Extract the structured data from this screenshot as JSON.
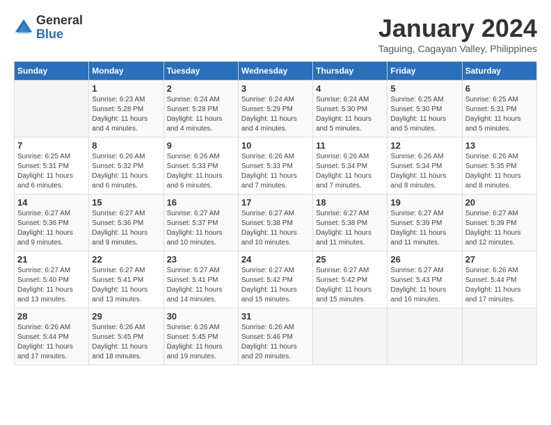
{
  "header": {
    "logo_general": "General",
    "logo_blue": "Blue",
    "month_title": "January 2024",
    "subtitle": "Taguing, Cagayan Valley, Philippines"
  },
  "weekdays": [
    "Sunday",
    "Monday",
    "Tuesday",
    "Wednesday",
    "Thursday",
    "Friday",
    "Saturday"
  ],
  "weeks": [
    [
      {
        "day": "",
        "info": ""
      },
      {
        "day": "1",
        "info": "Sunrise: 6:23 AM\nSunset: 5:28 PM\nDaylight: 11 hours\nand 4 minutes."
      },
      {
        "day": "2",
        "info": "Sunrise: 6:24 AM\nSunset: 5:28 PM\nDaylight: 11 hours\nand 4 minutes."
      },
      {
        "day": "3",
        "info": "Sunrise: 6:24 AM\nSunset: 5:29 PM\nDaylight: 11 hours\nand 4 minutes."
      },
      {
        "day": "4",
        "info": "Sunrise: 6:24 AM\nSunset: 5:30 PM\nDaylight: 11 hours\nand 5 minutes."
      },
      {
        "day": "5",
        "info": "Sunrise: 6:25 AM\nSunset: 5:30 PM\nDaylight: 11 hours\nand 5 minutes."
      },
      {
        "day": "6",
        "info": "Sunrise: 6:25 AM\nSunset: 5:31 PM\nDaylight: 11 hours\nand 5 minutes."
      }
    ],
    [
      {
        "day": "7",
        "info": "Sunrise: 6:25 AM\nSunset: 5:31 PM\nDaylight: 11 hours\nand 6 minutes."
      },
      {
        "day": "8",
        "info": "Sunrise: 6:26 AM\nSunset: 5:32 PM\nDaylight: 11 hours\nand 6 minutes."
      },
      {
        "day": "9",
        "info": "Sunrise: 6:26 AM\nSunset: 5:33 PM\nDaylight: 11 hours\nand 6 minutes."
      },
      {
        "day": "10",
        "info": "Sunrise: 6:26 AM\nSunset: 5:33 PM\nDaylight: 11 hours\nand 7 minutes."
      },
      {
        "day": "11",
        "info": "Sunrise: 6:26 AM\nSunset: 5:34 PM\nDaylight: 11 hours\nand 7 minutes."
      },
      {
        "day": "12",
        "info": "Sunrise: 6:26 AM\nSunset: 5:34 PM\nDaylight: 11 hours\nand 8 minutes."
      },
      {
        "day": "13",
        "info": "Sunrise: 6:26 AM\nSunset: 5:35 PM\nDaylight: 11 hours\nand 8 minutes."
      }
    ],
    [
      {
        "day": "14",
        "info": "Sunrise: 6:27 AM\nSunset: 5:36 PM\nDaylight: 11 hours\nand 9 minutes."
      },
      {
        "day": "15",
        "info": "Sunrise: 6:27 AM\nSunset: 5:36 PM\nDaylight: 11 hours\nand 9 minutes."
      },
      {
        "day": "16",
        "info": "Sunrise: 6:27 AM\nSunset: 5:37 PM\nDaylight: 11 hours\nand 10 minutes."
      },
      {
        "day": "17",
        "info": "Sunrise: 6:27 AM\nSunset: 5:38 PM\nDaylight: 11 hours\nand 10 minutes."
      },
      {
        "day": "18",
        "info": "Sunrise: 6:27 AM\nSunset: 5:38 PM\nDaylight: 11 hours\nand 11 minutes."
      },
      {
        "day": "19",
        "info": "Sunrise: 6:27 AM\nSunset: 5:39 PM\nDaylight: 11 hours\nand 11 minutes."
      },
      {
        "day": "20",
        "info": "Sunrise: 6:27 AM\nSunset: 5:39 PM\nDaylight: 11 hours\nand 12 minutes."
      }
    ],
    [
      {
        "day": "21",
        "info": "Sunrise: 6:27 AM\nSunset: 5:40 PM\nDaylight: 11 hours\nand 13 minutes."
      },
      {
        "day": "22",
        "info": "Sunrise: 6:27 AM\nSunset: 5:41 PM\nDaylight: 11 hours\nand 13 minutes."
      },
      {
        "day": "23",
        "info": "Sunrise: 6:27 AM\nSunset: 5:41 PM\nDaylight: 11 hours\nand 14 minutes."
      },
      {
        "day": "24",
        "info": "Sunrise: 6:27 AM\nSunset: 5:42 PM\nDaylight: 11 hours\nand 15 minutes."
      },
      {
        "day": "25",
        "info": "Sunrise: 6:27 AM\nSunset: 5:42 PM\nDaylight: 11 hours\nand 15 minutes."
      },
      {
        "day": "26",
        "info": "Sunrise: 6:27 AM\nSunset: 5:43 PM\nDaylight: 11 hours\nand 16 minutes."
      },
      {
        "day": "27",
        "info": "Sunrise: 6:26 AM\nSunset: 5:44 PM\nDaylight: 11 hours\nand 17 minutes."
      }
    ],
    [
      {
        "day": "28",
        "info": "Sunrise: 6:26 AM\nSunset: 5:44 PM\nDaylight: 11 hours\nand 17 minutes."
      },
      {
        "day": "29",
        "info": "Sunrise: 6:26 AM\nSunset: 5:45 PM\nDaylight: 11 hours\nand 18 minutes."
      },
      {
        "day": "30",
        "info": "Sunrise: 6:26 AM\nSunset: 5:45 PM\nDaylight: 11 hours\nand 19 minutes."
      },
      {
        "day": "31",
        "info": "Sunrise: 6:26 AM\nSunset: 5:46 PM\nDaylight: 11 hours\nand 20 minutes."
      },
      {
        "day": "",
        "info": ""
      },
      {
        "day": "",
        "info": ""
      },
      {
        "day": "",
        "info": ""
      }
    ]
  ]
}
